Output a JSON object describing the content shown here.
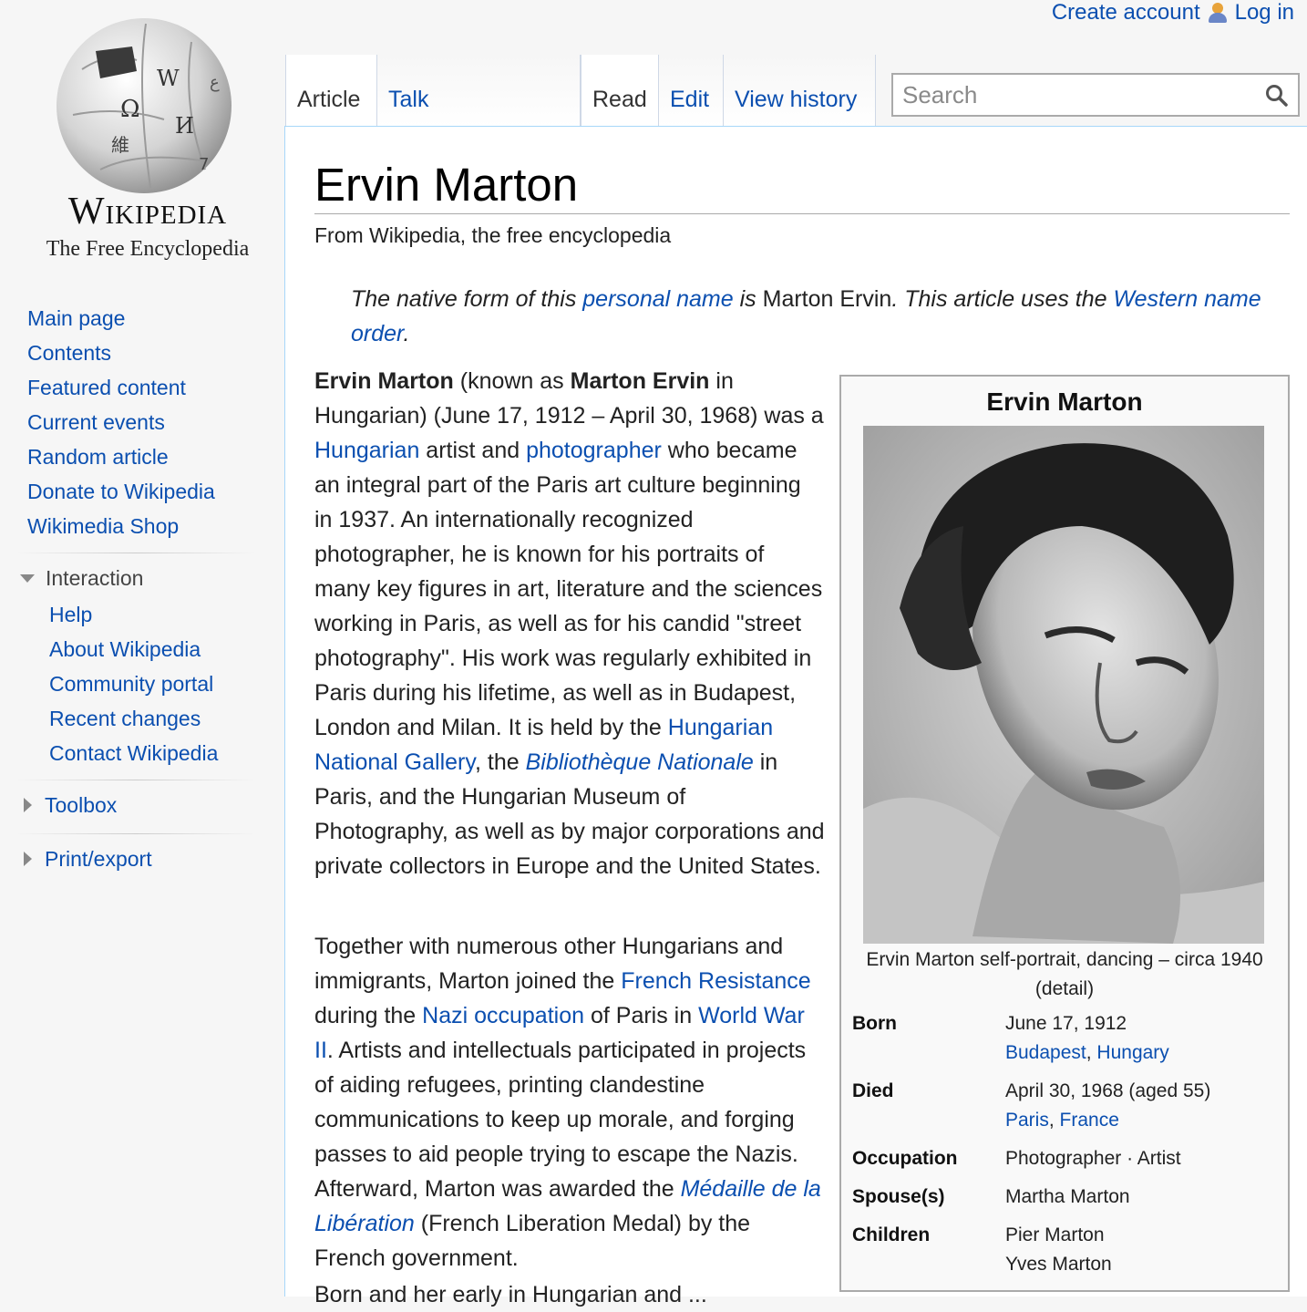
{
  "personal": {
    "create_account": "Create account",
    "log_in": "Log in"
  },
  "logo": {
    "wordmark": "Wikipedia",
    "tagline": "The Free Encyclopedia"
  },
  "sidebar": {
    "nav": [
      "Main page",
      "Contents",
      "Featured content",
      "Current events",
      "Random article",
      "Donate to Wikipedia",
      "Wikimedia Shop"
    ],
    "interaction": {
      "heading": "Interaction",
      "items": [
        "Help",
        "About Wikipedia",
        "Community portal",
        "Recent changes",
        "Contact Wikipedia"
      ]
    },
    "toolbox": "Toolbox",
    "print_export": "Print/export"
  },
  "tabs": {
    "article": "Article",
    "talk": "Talk",
    "read": "Read",
    "edit": "Edit",
    "history": "View history"
  },
  "search": {
    "placeholder": "Search"
  },
  "article": {
    "title": "Ervin Marton",
    "tagline": "From Wikipedia, the free encyclopedia",
    "hatnote": {
      "t1": "The native form of this ",
      "l1": "personal name",
      "t2": " is ",
      "t3": "Marton Ervin",
      "t4": ". This article uses the ",
      "l2": "Western name order",
      "t5": "."
    },
    "lead": {
      "b1": "Ervin Marton",
      "t1": " (known as ",
      "b2": "Marton Ervin",
      "t2": " in Hungarian) (June 17, 1912 – April 30, 1968) was a ",
      "l1": "Hungarian",
      "t3": " artist and ",
      "l2": "photographer",
      "t4": " who became an integral part of the Paris art culture beginning in 1937. An internationally recognized photographer, he is known for his portraits of many key figures in art, literature and the sciences working in Paris, as well as for his candid \"street photography\". His work was regularly exhibited in Paris during his lifetime, as well as in Budapest, London and Milan. It is held by the ",
      "l3": "Hungarian National Gallery",
      "t5": ", the ",
      "l4": "Bibliothèque Nationale",
      "t6": " in Paris, and the Hungarian Museum of Photography, as well as by major corporations and private collectors in Europe and the United States."
    },
    "para2": {
      "t1": "Together with numerous other Hungarians and immigrants, Marton joined the ",
      "l1": "French Resistance",
      "t2": " during the ",
      "l2": "Nazi occupation",
      "t3": " of Paris in ",
      "l3": "World War II",
      "t4": ". Artists and intellectuals participated in projects of aiding refugees, printing clandestine communications to keep up morale, and forging passes to aid people trying to escape the Nazis. Afterward, Marton was awarded the ",
      "l4": "Médaille de la Libération",
      "t5": " (French Liberation Medal) by the French government."
    },
    "para3": "Born and her early in Hungarian and ..."
  },
  "infobox": {
    "title": "Ervin Marton",
    "caption": "Ervin Marton self-portrait, dancing – circa 1940 (detail)",
    "born": {
      "label": "Born",
      "date": "June 17, 1912",
      "place1": "Budapest",
      "sep": ", ",
      "place2": "Hungary"
    },
    "died": {
      "label": "Died",
      "date": "April 30, 1968 (aged 55)",
      "place1": "Paris",
      "sep": ", ",
      "place2": "France"
    },
    "occupation": {
      "label": "Occupation",
      "value": "Photographer · Artist"
    },
    "spouse": {
      "label": "Spouse(s)",
      "value": "Martha Marton"
    },
    "children": {
      "label": "Children",
      "value1": "Pier Marton",
      "value2": "Yves Marton"
    }
  },
  "colors": {
    "link": "#0b4fb0",
    "content_border": "#a7d7f9",
    "sidebar_bg": "#f6f6f6"
  }
}
